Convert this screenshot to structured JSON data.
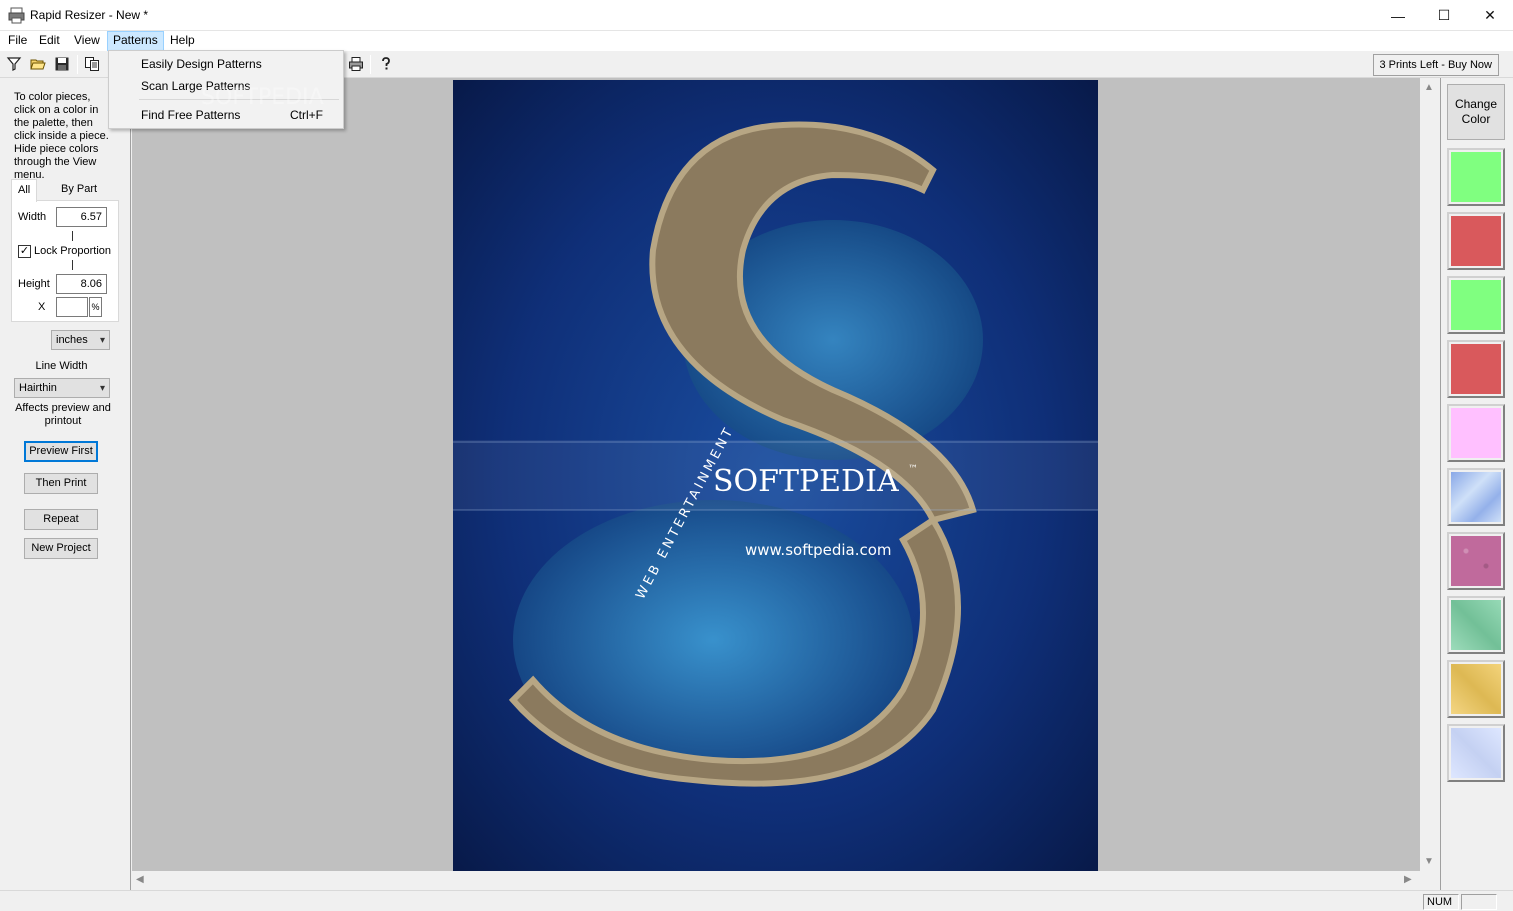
{
  "window": {
    "title": "Rapid Resizer - New *",
    "minimize_glyph": "—",
    "maximize_glyph": "☐",
    "close_glyph": "✕"
  },
  "menu": {
    "file": "File",
    "edit": "Edit",
    "view": "View",
    "patterns": "Patterns",
    "help": "Help"
  },
  "patterns_menu": {
    "items": [
      {
        "label": "Easily Design Patterns",
        "shortcut": ""
      },
      {
        "label": "Scan Large Patterns",
        "shortcut": ""
      },
      {
        "label": "Find Free Patterns",
        "shortcut": "Ctrl+F"
      }
    ]
  },
  "toolbar": {
    "icons": [
      "filter-icon",
      "open-folder-icon",
      "save-icon",
      "copy-icon",
      "print-icon",
      "help-icon"
    ],
    "buy_label": "3 Prints Left - Buy Now"
  },
  "left_panel": {
    "help_text": "To color pieces, click on a color in the palette, then click inside a piece. Hide piece colors through the View menu.",
    "tab_all": "All",
    "tab_by_part": "By Part",
    "width_label": "Width",
    "width_value": "6.57",
    "lock_label": "Lock Proportion",
    "lock_checked": true,
    "height_label": "Height",
    "height_value": "8.06",
    "x_label": "X",
    "x_value": "",
    "percent_label": "%",
    "units_value": "inches",
    "line_width_label": "Line Width",
    "line_width_value": "Hairthin",
    "affects_text": "Affects preview and printout",
    "preview_button": "Preview First",
    "print_button": "Then Print",
    "repeat_button": "Repeat",
    "new_project_button": "New Project"
  },
  "canvas": {
    "watermark_title": "SOFTPEDIA",
    "watermark_tm": "™",
    "watermark_url": "www.softpedia.com",
    "watermark_tagline": "WEB ENTERTAINMENT",
    "menu_watermark": "SOFTPEDIA",
    "bg_color": "#c0c0c0"
  },
  "right_panel": {
    "change_color_label": "Change Color",
    "swatches": [
      {
        "name": "light-green",
        "color": "#80ff80"
      },
      {
        "name": "coral-red",
        "color": "#d9595c"
      },
      {
        "name": "light-green",
        "color": "#80ff80"
      },
      {
        "name": "coral-red",
        "color": "#d9595c"
      },
      {
        "name": "pink",
        "color": "#ffc0ff"
      },
      {
        "name": "blue-marble",
        "color": "#cfe0f8"
      },
      {
        "name": "purple-texture",
        "color": "#c06a9c"
      },
      {
        "name": "green-texture",
        "color": "#7cd0a4"
      },
      {
        "name": "yellow-texture",
        "color": "#f0c85a"
      },
      {
        "name": "light-blue-texture",
        "color": "#cfdcff"
      }
    ]
  },
  "status": {
    "num": "NUM"
  }
}
